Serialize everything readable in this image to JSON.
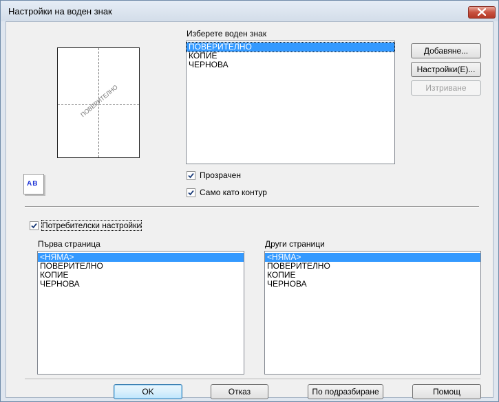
{
  "window": {
    "title": "Настройки на воден знак"
  },
  "preview": {
    "watermark_text": "ПОВЕРИТЕЛНО",
    "ab_icon_text": "AB"
  },
  "select_watermark": {
    "label": "Изберете воден знак",
    "items": [
      "ПОВЕРИТЕЛНО",
      "КОПИЕ",
      "ЧЕРНОВА"
    ],
    "selected": "ПОВЕРИТЕЛНО"
  },
  "side_buttons": {
    "add": "Добавяне...",
    "settings": "Настройки(E)...",
    "delete": "Изтриване"
  },
  "options": {
    "transparent": {
      "label": "Прозрачен",
      "checked": true
    },
    "outline": {
      "label": "Само като контур",
      "checked": true
    },
    "custom": {
      "label": "Потребителски настройки",
      "checked": true
    }
  },
  "first_page": {
    "label": "Първа страница",
    "items": [
      "<НЯМА>",
      "ПОВЕРИТЕЛНО",
      "КОПИЕ",
      "ЧЕРНОВА"
    ],
    "selected": "<НЯМА>"
  },
  "other_pages": {
    "label": "Други страници",
    "items": [
      "<НЯМА>",
      "ПОВЕРИТЕЛНО",
      "КОПИЕ",
      "ЧЕРНОВА"
    ],
    "selected": "<НЯМА>"
  },
  "footer": {
    "ok": "OK",
    "cancel": "Отказ",
    "defaults": "По подразбиране",
    "help": "Помощ"
  },
  "colors": {
    "selection": "#3399ff",
    "ab_icon": "#1f35d6",
    "close_button": "#c8513f"
  },
  "icons": {
    "close": "close-icon",
    "check": "check-icon"
  }
}
